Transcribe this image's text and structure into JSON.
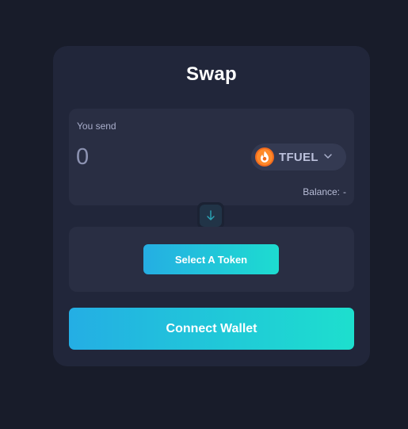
{
  "swap": {
    "title": "Swap",
    "send": {
      "label": "You send",
      "amount_placeholder": "0",
      "amount_value": "",
      "token": {
        "name": "TFUEL",
        "icon": "tfuel-flame-icon",
        "icon_color": "#f26b1d"
      },
      "balance_label": "Balance:",
      "balance_value": "-"
    },
    "switch_icon": "arrow-down-icon",
    "receive": {
      "select_token_label": "Select A Token"
    },
    "connect_wallet_label": "Connect Wallet"
  },
  "colors": {
    "background": "#181c2a",
    "card": "#21263a",
    "panel": "#292e43",
    "accent_start": "#24aee4",
    "accent_end": "#1ddfce"
  }
}
